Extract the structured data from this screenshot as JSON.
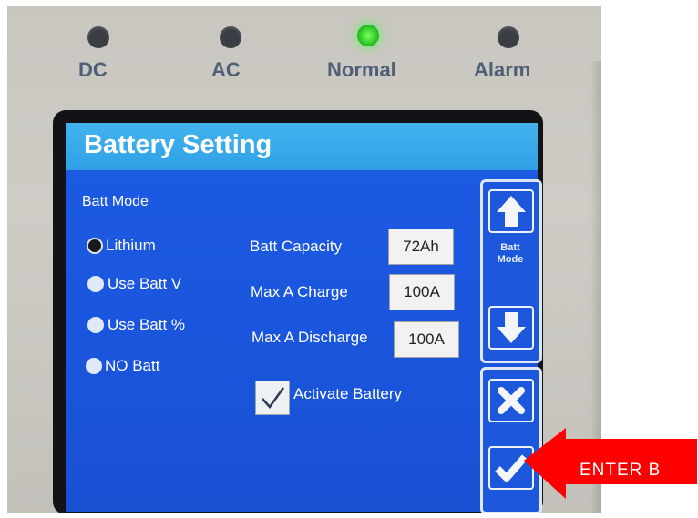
{
  "indicators": [
    {
      "label": "DC",
      "state": "off"
    },
    {
      "label": "AC",
      "state": "off"
    },
    {
      "label": "Normal",
      "state": "on"
    },
    {
      "label": "Alarm",
      "state": "off"
    }
  ],
  "screen": {
    "title": "Battery Setting",
    "batt_mode_label": "Batt Mode",
    "modes": [
      {
        "label": "Lithium",
        "selected": true
      },
      {
        "label": "Use Batt V",
        "selected": false
      },
      {
        "label": "Use Batt %",
        "selected": false
      },
      {
        "label": "NO Batt",
        "selected": false
      }
    ],
    "settings": [
      {
        "label": "Batt Capacity",
        "value": "72Ah"
      },
      {
        "label": "Max A Charge",
        "value": "100A"
      },
      {
        "label": "Max A Discharge",
        "value": "100A"
      }
    ],
    "activate_label": "Activate Battery",
    "activate_checked": true,
    "side_panel": {
      "label_line1": "Batt",
      "label_line2": "Mode"
    }
  },
  "annotation": {
    "label": "ENTER B",
    "color": "#ff0000"
  },
  "colors": {
    "screen_bg": "#1d5be4",
    "titlebar": "#3aaaeb",
    "led_on": "#3ee03a"
  }
}
